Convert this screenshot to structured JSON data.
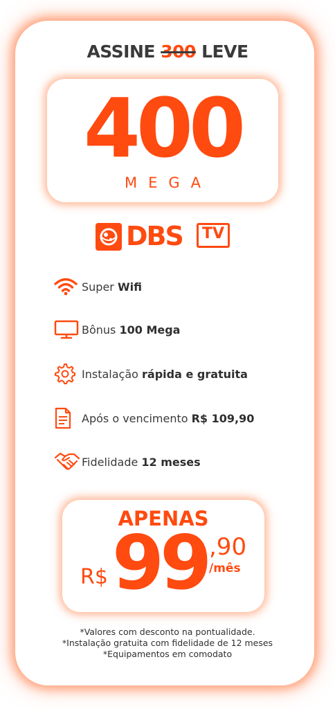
{
  "headline": {
    "prefix": "ASSINE",
    "struck": "300",
    "suffix": "LEVE"
  },
  "speed": {
    "number": "400",
    "unit": "MEGA"
  },
  "logo": {
    "brand": "DBS",
    "tv": "TV"
  },
  "features": [
    {
      "icon": "wifi-icon",
      "text": "Super ",
      "bold": "Wifi"
    },
    {
      "icon": "monitor-icon",
      "text": "Bônus ",
      "bold": "100 Mega"
    },
    {
      "icon": "gear-icon",
      "text": "Instalação ",
      "bold": "rápida e gratuita"
    },
    {
      "icon": "document-icon",
      "text": "Após o vencimento ",
      "bold": "R$ 109,90"
    },
    {
      "icon": "handshake-icon",
      "text": "Fidelidade ",
      "bold": "12 meses"
    }
  ],
  "price": {
    "label": "APENAS",
    "currency": "R$",
    "main": "99",
    "cents": ",90",
    "period": "/mês"
  },
  "footnotes": [
    "*Valores com desconto na pontualidade.",
    "*Instalação gratuita com fidelidade de 12 meses",
    "*Equipamentos em comodato"
  ],
  "colors": {
    "accent": "#ff4a10",
    "text": "#3a3a3a"
  }
}
